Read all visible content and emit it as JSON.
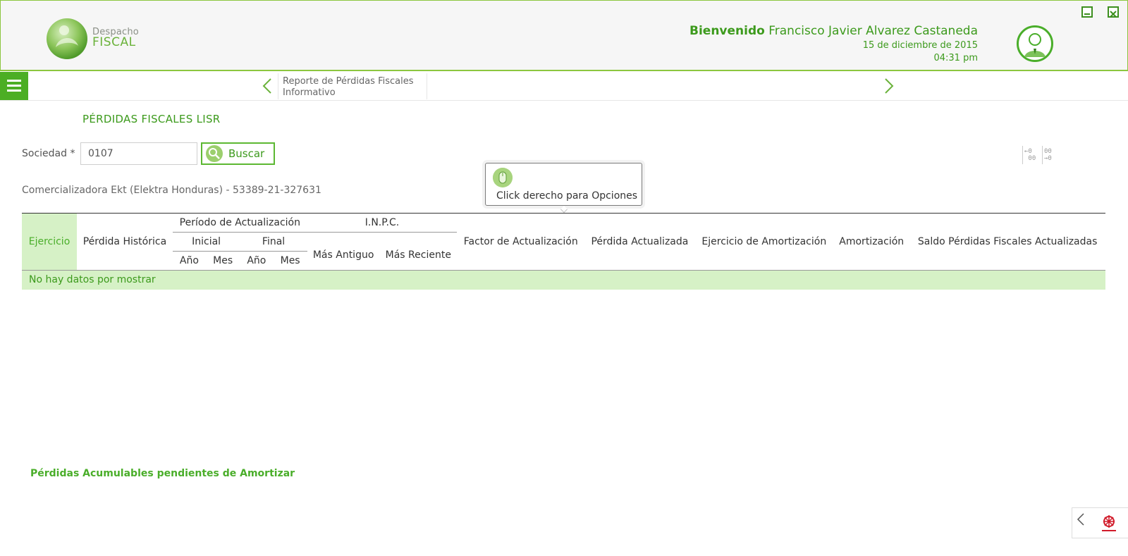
{
  "header": {
    "logo_line1": "Despacho",
    "logo_line2": "FISCAL",
    "welcome_label": "Bienvenido",
    "user_name": "Francisco Javier Alvarez Castaneda",
    "date": "15 de diciembre de 2015",
    "time": "04:31 pm"
  },
  "nav": {
    "breadcrumb_line1": "Reporte de Pérdidas Fiscales",
    "breadcrumb_line2": "Informativo"
  },
  "page": {
    "title": "PÉRDIDAS FISCALES LISR",
    "sociedad_label": "Sociedad *",
    "sociedad_value": "0107",
    "buscar_label": "Buscar",
    "company_info": "Comercializadora Ekt (Elektra Honduras) - 53389-21-327631",
    "tooltip_text": "Click derecho para Opciones",
    "section_subtitle": "Pérdidas Acumulables pendientes de Amortizar"
  },
  "table": {
    "col_ejercicio": "Ejercicio",
    "col_perdida_historica": "Pérdida Histórica",
    "group_periodo": "Período de Actualización",
    "group_inicial": "Inicial",
    "group_final": "Final",
    "col_anio": "Año",
    "col_mes": "Mes",
    "group_inpc": "I.N.P.C.",
    "col_mas_antiguo": "Más Antiguo",
    "col_mas_reciente": "Más Reciente",
    "col_factor": "Factor de Actualización",
    "col_perdida_actualizada": "Pérdida Actualizada",
    "col_ejercicio_amort": "Ejercicio de Amortización",
    "col_amortizacion": "Amortización",
    "col_saldo": "Saldo Pérdidas Fiscales Actualizadas",
    "empty_message": "No hay datos por mostrar"
  },
  "colors": {
    "brand_green": "#4cae24",
    "text_green": "#3c9a1c",
    "highlight_green": "#d6f1c6"
  }
}
